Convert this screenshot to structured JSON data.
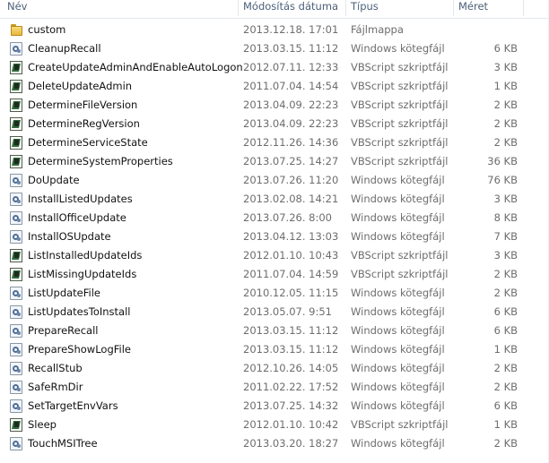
{
  "columns": {
    "name": "Név",
    "date": "Módosítás dátuma",
    "type": "Típus",
    "size": "Méret"
  },
  "files": [
    {
      "icon": "folder-icon",
      "name": "custom",
      "date": "2013.12.18. 17:01",
      "type": "Fájlmappa",
      "size": ""
    },
    {
      "icon": "batch-file-icon",
      "name": "CleanupRecall",
      "date": "2013.03.15. 11:12",
      "type": "Windows kötegfájl",
      "size": "6 KB"
    },
    {
      "icon": "vbscript-file-icon",
      "name": "CreateUpdateAdminAndEnableAutoLogon",
      "date": "2012.07.11. 12:33",
      "type": "VBScript szkriptfájl",
      "size": "3 KB"
    },
    {
      "icon": "vbscript-file-icon",
      "name": "DeleteUpdateAdmin",
      "date": "2011.07.04. 14:54",
      "type": "VBScript szkriptfájl",
      "size": "1 KB"
    },
    {
      "icon": "vbscript-file-icon",
      "name": "DetermineFileVersion",
      "date": "2013.04.09. 22:23",
      "type": "VBScript szkriptfájl",
      "size": "2 KB"
    },
    {
      "icon": "vbscript-file-icon",
      "name": "DetermineRegVersion",
      "date": "2013.04.09. 22:23",
      "type": "VBScript szkriptfájl",
      "size": "2 KB"
    },
    {
      "icon": "vbscript-file-icon",
      "name": "DetermineServiceState",
      "date": "2012.11.26. 14:36",
      "type": "VBScript szkriptfájl",
      "size": "2 KB"
    },
    {
      "icon": "vbscript-file-icon",
      "name": "DetermineSystemProperties",
      "date": "2013.07.25. 14:27",
      "type": "VBScript szkriptfájl",
      "size": "36 KB"
    },
    {
      "icon": "batch-file-icon",
      "name": "DoUpdate",
      "date": "2013.07.26. 11:20",
      "type": "Windows kötegfájl",
      "size": "76 KB"
    },
    {
      "icon": "batch-file-icon",
      "name": "InstallListedUpdates",
      "date": "2013.02.08. 14:21",
      "type": "Windows kötegfájl",
      "size": "3 KB"
    },
    {
      "icon": "batch-file-icon",
      "name": "InstallOfficeUpdate",
      "date": "2013.07.26. 8:00",
      "type": "Windows kötegfájl",
      "size": "8 KB"
    },
    {
      "icon": "batch-file-icon",
      "name": "InstallOSUpdate",
      "date": "2013.04.12. 13:03",
      "type": "Windows kötegfájl",
      "size": "7 KB"
    },
    {
      "icon": "vbscript-file-icon",
      "name": "ListInstalledUpdateIds",
      "date": "2012.01.10. 10:43",
      "type": "VBScript szkriptfájl",
      "size": "3 KB"
    },
    {
      "icon": "vbscript-file-icon",
      "name": "ListMissingUpdateIds",
      "date": "2011.07.04. 14:59",
      "type": "VBScript szkriptfájl",
      "size": "2 KB"
    },
    {
      "icon": "batch-file-icon",
      "name": "ListUpdateFile",
      "date": "2010.12.05. 11:15",
      "type": "Windows kötegfájl",
      "size": "2 KB"
    },
    {
      "icon": "batch-file-icon",
      "name": "ListUpdatesToInstall",
      "date": "2013.05.07. 9:51",
      "type": "Windows kötegfájl",
      "size": "6 KB"
    },
    {
      "icon": "batch-file-icon",
      "name": "PrepareRecall",
      "date": "2013.03.15. 11:12",
      "type": "Windows kötegfájl",
      "size": "6 KB"
    },
    {
      "icon": "batch-file-icon",
      "name": "PrepareShowLogFile",
      "date": "2013.03.15. 11:12",
      "type": "Windows kötegfájl",
      "size": "1 KB"
    },
    {
      "icon": "batch-file-icon",
      "name": "RecallStub",
      "date": "2012.10.26. 14:05",
      "type": "Windows kötegfájl",
      "size": "2 KB"
    },
    {
      "icon": "batch-file-icon",
      "name": "SafeRmDir",
      "date": "2011.02.22. 17:52",
      "type": "Windows kötegfájl",
      "size": "2 KB"
    },
    {
      "icon": "batch-file-icon",
      "name": "SetTargetEnvVars",
      "date": "2013.07.25. 14:32",
      "type": "Windows kötegfájl",
      "size": "6 KB"
    },
    {
      "icon": "vbscript-file-icon",
      "name": "Sleep",
      "date": "2012.01.10. 10:42",
      "type": "VBScript szkriptfájl",
      "size": "1 KB"
    },
    {
      "icon": "batch-file-icon",
      "name": "TouchMSITree",
      "date": "2013.03.20. 18:27",
      "type": "Windows kötegfájl",
      "size": "2 KB"
    }
  ]
}
